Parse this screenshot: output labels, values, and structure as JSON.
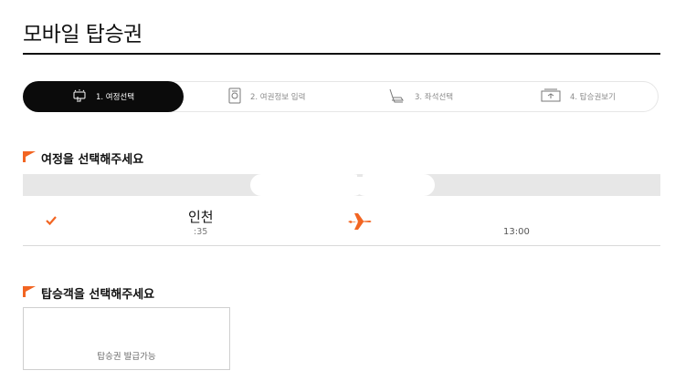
{
  "page": {
    "title": "모바일 탑승권"
  },
  "steps": [
    {
      "label": "1. 여정선택",
      "icon": "touch-hand-icon",
      "active": true
    },
    {
      "label": "2. 여권정보 입력",
      "icon": "passport-icon",
      "active": false
    },
    {
      "label": "3. 좌석선택",
      "icon": "seat-icon",
      "active": false
    },
    {
      "label": "4. 탑승권보기",
      "icon": "ticket-icon",
      "active": false
    }
  ],
  "itinerary": {
    "heading": "여정을 선택해주세요",
    "flight": {
      "origin_city": "인천",
      "departure_time": ":35",
      "arrival_time": "13:00",
      "icon": "airplane-icon",
      "selected": true
    }
  },
  "passengers": {
    "heading": "탑승객을 선택해주세요",
    "items": [
      {
        "status": "탑승권 발급가능"
      }
    ]
  },
  "colors": {
    "accent": "#f26522",
    "dark": "#0b0b0b",
    "band": "#e7e7e7"
  }
}
